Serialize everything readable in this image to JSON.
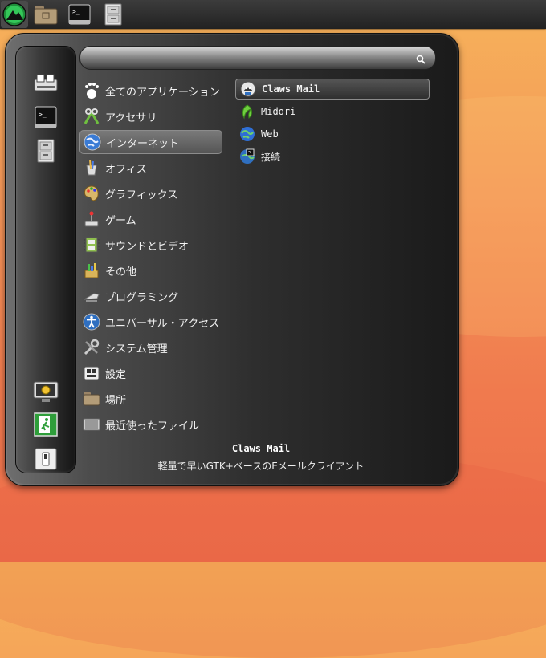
{
  "taskbar": {
    "buttons": [
      {
        "icon": "menu-logo-icon"
      },
      {
        "icon": "file-manager-icon"
      },
      {
        "icon": "terminal-icon"
      },
      {
        "icon": "filing-cabinet-icon"
      }
    ]
  },
  "search": {
    "value": "",
    "icon": "search-icon"
  },
  "sidebar": {
    "top": [
      {
        "icon": "network-printer-icon"
      },
      {
        "icon": "terminal-icon"
      },
      {
        "icon": "filing-cabinet-icon"
      }
    ],
    "bottom": [
      {
        "icon": "lock-screen-icon"
      },
      {
        "icon": "logout-icon"
      },
      {
        "icon": "shutdown-icon"
      }
    ]
  },
  "categories": [
    {
      "label": "全てのアプリケーション",
      "icon": "gnome-foot-icon"
    },
    {
      "label": "アクセサリ",
      "icon": "accessories-icon"
    },
    {
      "label": "インターネット",
      "icon": "globe-icon",
      "selected": true
    },
    {
      "label": "オフィス",
      "icon": "office-icon"
    },
    {
      "label": "グラフィックス",
      "icon": "palette-icon"
    },
    {
      "label": "ゲーム",
      "icon": "joystick-icon"
    },
    {
      "label": "サウンドとビデオ",
      "icon": "film-icon"
    },
    {
      "label": "その他",
      "icon": "other-icon"
    },
    {
      "label": "プログラミング",
      "icon": "programming-icon"
    },
    {
      "label": "ユニバーサル・アクセス",
      "icon": "accessibility-icon"
    },
    {
      "label": "システム管理",
      "icon": "tools-icon"
    },
    {
      "label": "設定",
      "icon": "settings-icon"
    },
    {
      "label": "場所",
      "icon": "folder-icon"
    },
    {
      "label": "最近使ったファイル",
      "icon": "recent-files-icon"
    }
  ],
  "apps": [
    {
      "label": "Claws Mail",
      "icon": "claws-mail-icon",
      "selected": true
    },
    {
      "label": "Midori",
      "icon": "midori-icon"
    },
    {
      "label": "Web",
      "icon": "web-globe-icon"
    },
    {
      "label": "接続",
      "icon": "network-connect-icon"
    }
  ],
  "description": {
    "title": "Claws Mail",
    "text": "軽量で早いGTK+ベースのEメールクライアント"
  }
}
